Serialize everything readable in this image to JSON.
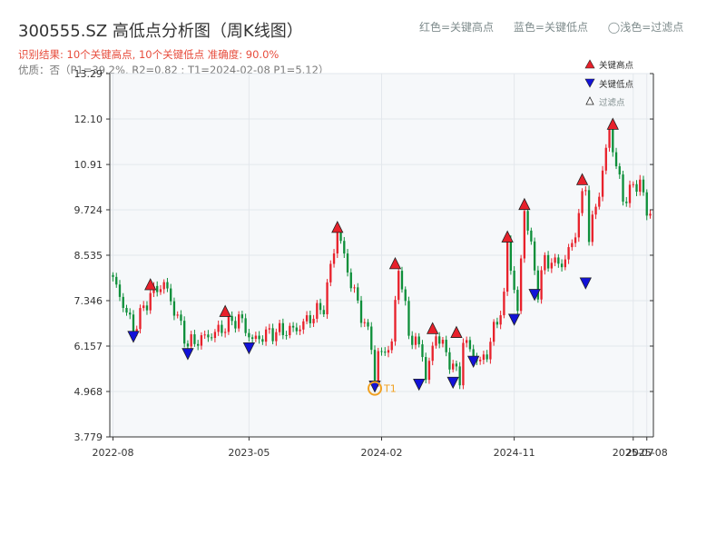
{
  "header": {
    "title": "300555.SZ 高低点分析图（周K线图）",
    "result_line": "识别结果: 10个关键高点, 10个关键低点  准确度: 90.0%",
    "quality_line": "优质：否（P1=39.2%, R2=0.82 ; T1=2024-02-08 P1=5.12）"
  },
  "top_legend": {
    "red_label": "红色=关键高点",
    "blue_label": "蓝色=关键低点",
    "light_label": "◯浅色=过滤点"
  },
  "colors": {
    "up": "#e8212b",
    "down": "#0e8f3a",
    "high_marker": "#e8212b",
    "low_marker": "#1212d8",
    "t1_marker": "#f0a020",
    "plot_bg": "#f6f8fa"
  },
  "chart_data": {
    "type": "candlestick",
    "ylim": [
      3.779,
      13.29
    ],
    "yticks": [
      3.779,
      4.968,
      6.157,
      7.346,
      8.535,
      9.724,
      10.91,
      12.1,
      13.29
    ],
    "ytick_labels": [
      "3.779",
      "4.968",
      "6.157",
      "7.346",
      "8.535",
      "9.724",
      "10.91",
      "12.10",
      "13.29"
    ],
    "xticks": [
      {
        "label": "2022-08",
        "index": 0
      },
      {
        "label": "2023-05",
        "index": 40
      },
      {
        "label": "2024-02",
        "index": 79
      },
      {
        "label": "2024-11",
        "index": 118
      },
      {
        "label": "2025-07",
        "index": 153
      },
      {
        "label": "2025-08",
        "index": 157
      }
    ],
    "legend": {
      "position": "top-right",
      "entries": [
        "关键高点",
        "关键低点",
        "过滤点"
      ]
    },
    "n_bars": 159,
    "anchors": [
      [
        0,
        7.9
      ],
      [
        6,
        6.6
      ],
      [
        11,
        7.5
      ],
      [
        15,
        7.8
      ],
      [
        22,
        6.2
      ],
      [
        30,
        6.5
      ],
      [
        37,
        6.9
      ],
      [
        39,
        6.6
      ],
      [
        41,
        6.3
      ],
      [
        46,
        6.5
      ],
      [
        54,
        6.6
      ],
      [
        62,
        7.2
      ],
      [
        66,
        9.2
      ],
      [
        70,
        7.8
      ],
      [
        76,
        6.2
      ],
      [
        77,
        5.3
      ],
      [
        78,
        5.9
      ],
      [
        82,
        6.2
      ],
      [
        84,
        8.3
      ],
      [
        87,
        6.5
      ],
      [
        91,
        6.0
      ],
      [
        92,
        5.3
      ],
      [
        95,
        6.5
      ],
      [
        100,
        5.6
      ],
      [
        102,
        5.3
      ],
      [
        103,
        6.3
      ],
      [
        108,
        5.7
      ],
      [
        110,
        6.0
      ],
      [
        115,
        7.4
      ],
      [
        116,
        8.9
      ],
      [
        119,
        7.0
      ],
      [
        121,
        9.8
      ],
      [
        125,
        7.6
      ],
      [
        127,
        8.4
      ],
      [
        132,
        8.3
      ],
      [
        135,
        8.8
      ],
      [
        139,
        10.4
      ],
      [
        140,
        9.0
      ],
      [
        143,
        10.2
      ],
      [
        146,
        11.8
      ],
      [
        150,
        10.0
      ],
      [
        155,
        10.5
      ],
      [
        157,
        9.6
      ],
      [
        158,
        9.7
      ]
    ],
    "key_highs": [
      {
        "index": 11,
        "value": 7.75
      },
      {
        "index": 33,
        "value": 7.05
      },
      {
        "index": 66,
        "value": 9.25
      },
      {
        "index": 83,
        "value": 8.3
      },
      {
        "index": 94,
        "value": 6.6
      },
      {
        "index": 101,
        "value": 6.5
      },
      {
        "index": 116,
        "value": 9.0
      },
      {
        "index": 121,
        "value": 9.85
      },
      {
        "index": 138,
        "value": 10.5
      },
      {
        "index": 147,
        "value": 11.95
      }
    ],
    "key_lows": [
      {
        "index": 6,
        "value": 6.4
      },
      {
        "index": 22,
        "value": 5.95
      },
      {
        "index": 40,
        "value": 6.1
      },
      {
        "index": 77,
        "value": 5.1
      },
      {
        "index": 90,
        "value": 5.15
      },
      {
        "index": 100,
        "value": 5.2
      },
      {
        "index": 106,
        "value": 5.75
      },
      {
        "index": 118,
        "value": 6.85
      },
      {
        "index": 124,
        "value": 7.5
      },
      {
        "index": 139,
        "value": 7.8
      }
    ],
    "t1_point": {
      "index": 77,
      "value": 5.12,
      "label": "T1"
    }
  }
}
